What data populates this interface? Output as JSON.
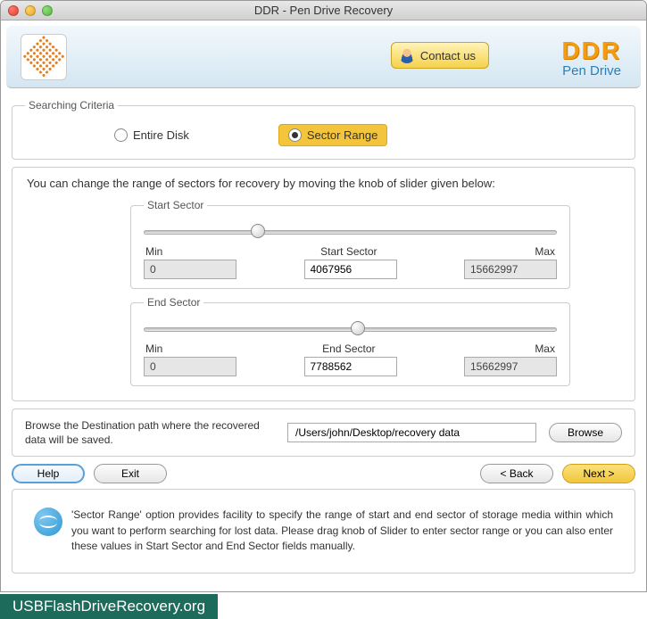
{
  "window": {
    "title": "DDR - Pen Drive Recovery"
  },
  "header": {
    "contact_label": "Contact us",
    "brand": "DDR",
    "brand_sub": "Pen Drive"
  },
  "criteria": {
    "legend": "Searching Criteria",
    "entire_disk_label": "Entire Disk",
    "sector_range_label": "Sector Range",
    "selected": "sector_range"
  },
  "sector_box": {
    "info": "You can change the range of sectors for recovery by moving the knob of slider given below:",
    "start": {
      "legend": "Start Sector",
      "min_label": "Min",
      "mid_label": "Start Sector",
      "max_label": "Max",
      "min": "0",
      "value": "4067956",
      "max": "15662997",
      "knob_percent": 26
    },
    "end": {
      "legend": "End Sector",
      "min_label": "Min",
      "mid_label": "End Sector",
      "max_label": "Max",
      "min": "0",
      "value": "7788562",
      "max": "15662997",
      "knob_percent": 50
    }
  },
  "destination": {
    "prompt": "Browse the Destination path where the recovered data will be saved.",
    "path": "/Users/john/Desktop/recovery data",
    "browse_label": "Browse"
  },
  "buttons": {
    "help": "Help",
    "exit": "Exit",
    "back": "< Back",
    "next": "Next >"
  },
  "hint": "'Sector Range' option provides facility to specify the range of start and end sector of storage media within which you want to perform searching for lost data. Please drag knob of Slider to enter sector range or you can also enter these values in Start Sector and End Sector fields manually.",
  "footer": "USBFlashDriveRecovery.org"
}
